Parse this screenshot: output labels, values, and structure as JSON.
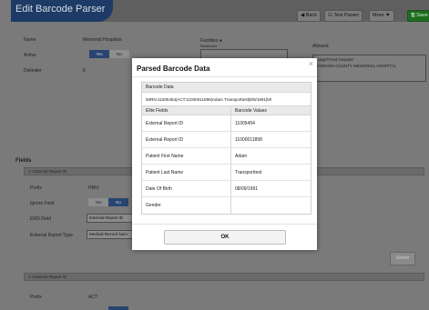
{
  "app": {
    "title": "Edit Barcode Parser",
    "toolbar": {
      "back_label": "◀ Back",
      "test_parser_label": "☷ Test Parser",
      "more_label": "More ▼",
      "save_label": "🖫 Save"
    }
  },
  "form": {
    "name_label": "Name",
    "name_value": "Memorial Hospitals",
    "active_label": "Active",
    "active_yes": "Yes",
    "active_no": "No",
    "delimiter_label": "Delimiter",
    "delimiter_value": "8",
    "facilities_label": "Facilities ●",
    "facilities_sub": "Restricted",
    "allowed_label": "Allowed",
    "allowed_items": [
      "ImageTrend Hospital",
      "HAWKINS COUNTY MEMORIAL HOSPITAL"
    ],
    "fields_heading": "Fields",
    "section1_label": "1: External Report ID",
    "prefix_label": "Prefix",
    "prefix_value": "HRN:",
    "ignore_label": "Ignore Field",
    "ignore_yes": "Yes",
    "ignore_no": "No",
    "ems_label": "EMS Field",
    "ems_value": "External Report ID",
    "ext_type_label": "External Report Type",
    "ext_type_value": "Medical Record Num",
    "delete_label": "Delete",
    "section2_label": "2: External Report ID",
    "prefix2_label": "Prefix",
    "prefix2_value": "ACT:"
  },
  "modal": {
    "title": "Parsed Barcode Data",
    "close_glyph": "×",
    "barcode_header": "Barcode Data",
    "barcode_raw": "\\MRN:11005454|ACT:11000011898|Adam Transporttest|8/9/1991|M\\",
    "col_field": "Elite Fields",
    "col_value": "Barcode Values",
    "rows": [
      {
        "field": "External Report ID",
        "value": "11005454"
      },
      {
        "field": "External Report ID",
        "value": "11000011898"
      },
      {
        "field": "Patient First Name",
        "value": "Adam"
      },
      {
        "field": "Patient Last Name",
        "value": "Transporttest"
      },
      {
        "field": "Date Of Birth",
        "value": "08/09/1991"
      },
      {
        "field": "Gender",
        "value": ""
      }
    ],
    "ok_label": "OK"
  }
}
